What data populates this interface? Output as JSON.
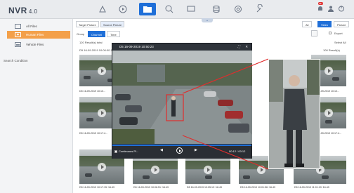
{
  "header": {
    "logo": "NVR",
    "version": "4.0",
    "notification_count": "99+",
    "nav_icons": [
      "live-view-icon",
      "playback-icon",
      "file-management-icon",
      "search-icon",
      "monitor-icon",
      "storage-icon",
      "settings-icon",
      "maintenance-icon"
    ],
    "active_nav": "file-management-icon"
  },
  "sidebar": {
    "items": [
      {
        "label": "All Files",
        "icon": "files-icon"
      },
      {
        "label": "Human Files",
        "icon": "human-icon",
        "active": true
      },
      {
        "label": "Vehicle Files",
        "icon": "vehicle-icon"
      }
    ],
    "search_condition": "Search Condition"
  },
  "toolbar": {
    "target_picture": "Target Picture",
    "source_picture": "Source Picture",
    "group_label": "Group",
    "channel": "Channel",
    "time": "Time",
    "filter_all": "All",
    "filter_video": "Video",
    "filter_picture": "Picture",
    "export": "Export",
    "select_all": "Select All"
  },
  "results": {
    "group1": "120 Result(s) total",
    "group2": "D5 16-09-2019 10:00:00-11:00:00",
    "group2_count": "100 Result(s)"
  },
  "player": {
    "title": "D5 16-09-2019 10:50:23",
    "continuous_label": "Continuous Pl...",
    "time": "00:12 / 00:12"
  },
  "thumbs": {
    "labels": [
      "D5 16-09-2019 10:10...",
      "D5 16-09-2019 10:10...",
      "D5 16-09-2019 10:10...",
      "D5 16-09-2019 10:10...",
      "D5 16-09-2019 10:17:4...",
      "D5 16-09-2019 10:17:4...",
      "D5 16-09-2019 10:17:4...",
      "D5 16-09-2019 10:17:4...",
      "D5 16-09-2019 10:17:15~16:49",
      "D5 16-09-2019 10:06:51~16:49",
      "D5 16-09-2019 10:05:13~16:49",
      "D5 16-09-2019 10:01:56~16:49",
      "D5 16-09-2019 11:01:19~16:49"
    ]
  },
  "colors": {
    "accent_blue": "#1f6fd8",
    "active_orange": "#f3a04a",
    "highlight_red": "#e02d2d"
  }
}
